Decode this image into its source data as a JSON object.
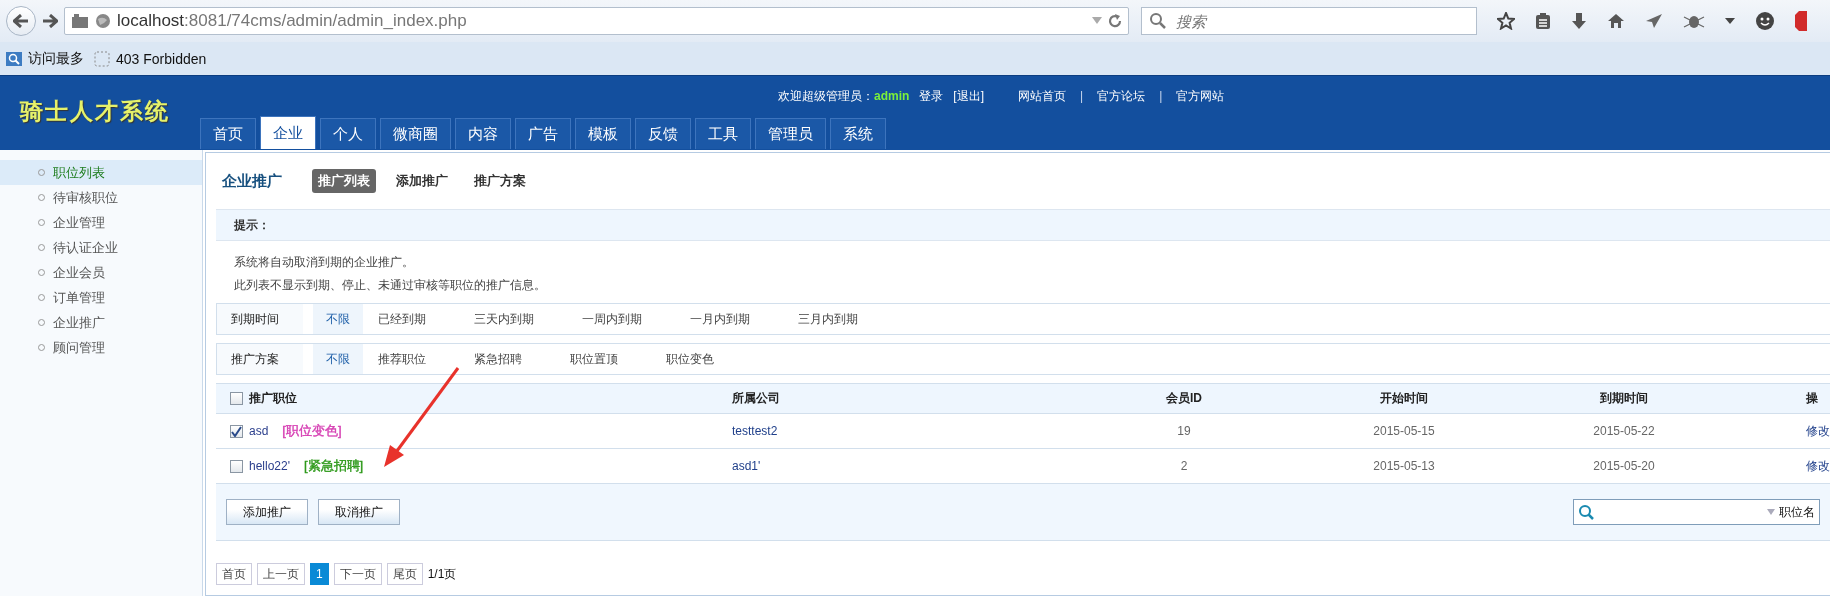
{
  "browser": {
    "url_host": "localhost",
    "url_rest": ":8081/74cms/admin/admin_index.php",
    "search_placeholder": "搜索"
  },
  "bookmarks": [
    {
      "label": "访问最多",
      "kind": "folder"
    },
    {
      "label": "403 Forbidden",
      "kind": "page"
    }
  ],
  "header": {
    "logo": "骑士人才系统",
    "welcome": "欢迎超级管理员：",
    "user": "admin",
    "account_links": [
      "登录",
      "[退出]"
    ],
    "site_links": [
      {
        "kind": "link",
        "label": "网站首页"
      },
      {
        "kind": "separator",
        "label": "|"
      },
      {
        "kind": "link",
        "label": "官方论坛"
      },
      {
        "kind": "separator",
        "label": "|"
      },
      {
        "kind": "link",
        "label": "官方网站"
      }
    ]
  },
  "nav_tabs": [
    {
      "label": "首页",
      "selected": false
    },
    {
      "label": "企业",
      "selected": true
    },
    {
      "label": "个人",
      "selected": false
    },
    {
      "label": "微商圈",
      "selected": false
    },
    {
      "label": "内容",
      "selected": false
    },
    {
      "label": "广告",
      "selected": false
    },
    {
      "label": "模板",
      "selected": false
    },
    {
      "label": "反馈",
      "selected": false
    },
    {
      "label": "工具",
      "selected": false
    },
    {
      "label": "管理员",
      "selected": false
    },
    {
      "label": "系统",
      "selected": false
    }
  ],
  "sidebar": {
    "items": [
      {
        "label": "职位列表",
        "selected": true
      },
      {
        "label": "待审核职位",
        "selected": false
      },
      {
        "label": "企业管理",
        "selected": false
      },
      {
        "label": "待认证企业",
        "selected": false
      },
      {
        "label": "企业会员",
        "selected": false
      },
      {
        "label": "订单管理",
        "selected": false
      },
      {
        "label": "企业推广",
        "selected": false
      },
      {
        "label": "顾问管理",
        "selected": false
      }
    ]
  },
  "page": {
    "title": "企业推广",
    "subtabs": [
      {
        "label": "推广列表",
        "selected": true
      },
      {
        "label": "添加推广",
        "selected": false
      },
      {
        "label": "推广方案",
        "selected": false
      }
    ],
    "tip": {
      "title": "提示：",
      "lines": [
        "系统将自动取消到期的企业推广。",
        "此列表不显示到期、停止、未通过审核等职位的推广信息。"
      ]
    },
    "filters": [
      {
        "label": "到期时间",
        "options": [
          {
            "label": "不限",
            "selected": true
          },
          {
            "label": "已经到期",
            "selected": false
          },
          {
            "label": "三天内到期",
            "selected": false
          },
          {
            "label": "一周内到期",
            "selected": false
          },
          {
            "label": "一月内到期",
            "selected": false
          },
          {
            "label": "三月内到期",
            "selected": false
          }
        ]
      },
      {
        "label": "推广方案",
        "options": [
          {
            "label": "不限",
            "selected": true
          },
          {
            "label": "推荐职位",
            "selected": false
          },
          {
            "label": "紧急招聘",
            "selected": false
          },
          {
            "label": "职位置顶",
            "selected": false
          },
          {
            "label": "职位变色",
            "selected": false
          }
        ]
      }
    ],
    "table": {
      "select_all_checked": false,
      "columns": [
        "推广职位",
        "所属公司",
        "会员ID",
        "开始时间",
        "到期时间",
        "操"
      ],
      "rows": [
        {
          "checked": true,
          "title": "asd",
          "tag": {
            "label": "[职位变色]",
            "color": "#d63fb3"
          },
          "company": "testtest2",
          "member_id": "19",
          "start": "2015-05-15",
          "end": "2015-05-22",
          "action": "修改"
        },
        {
          "checked": false,
          "title": "hello22'",
          "tag": {
            "label": "[紧急招聘]",
            "color": "#2f9a1c"
          },
          "company": "asd1'",
          "member_id": "2",
          "start": "2015-05-13",
          "end": "2015-05-20",
          "action": "修改"
        }
      ]
    },
    "buttons": [
      "添加推广",
      "取消推广"
    ],
    "search": {
      "option": "职位名"
    },
    "pagination": [
      {
        "label": "首页",
        "selected": false
      },
      {
        "label": "上一页",
        "selected": false
      },
      {
        "label": "1",
        "selected": true
      },
      {
        "label": "下一页",
        "selected": false
      },
      {
        "label": "尾页",
        "selected": false
      }
    ],
    "page_count": "1/1页"
  }
}
